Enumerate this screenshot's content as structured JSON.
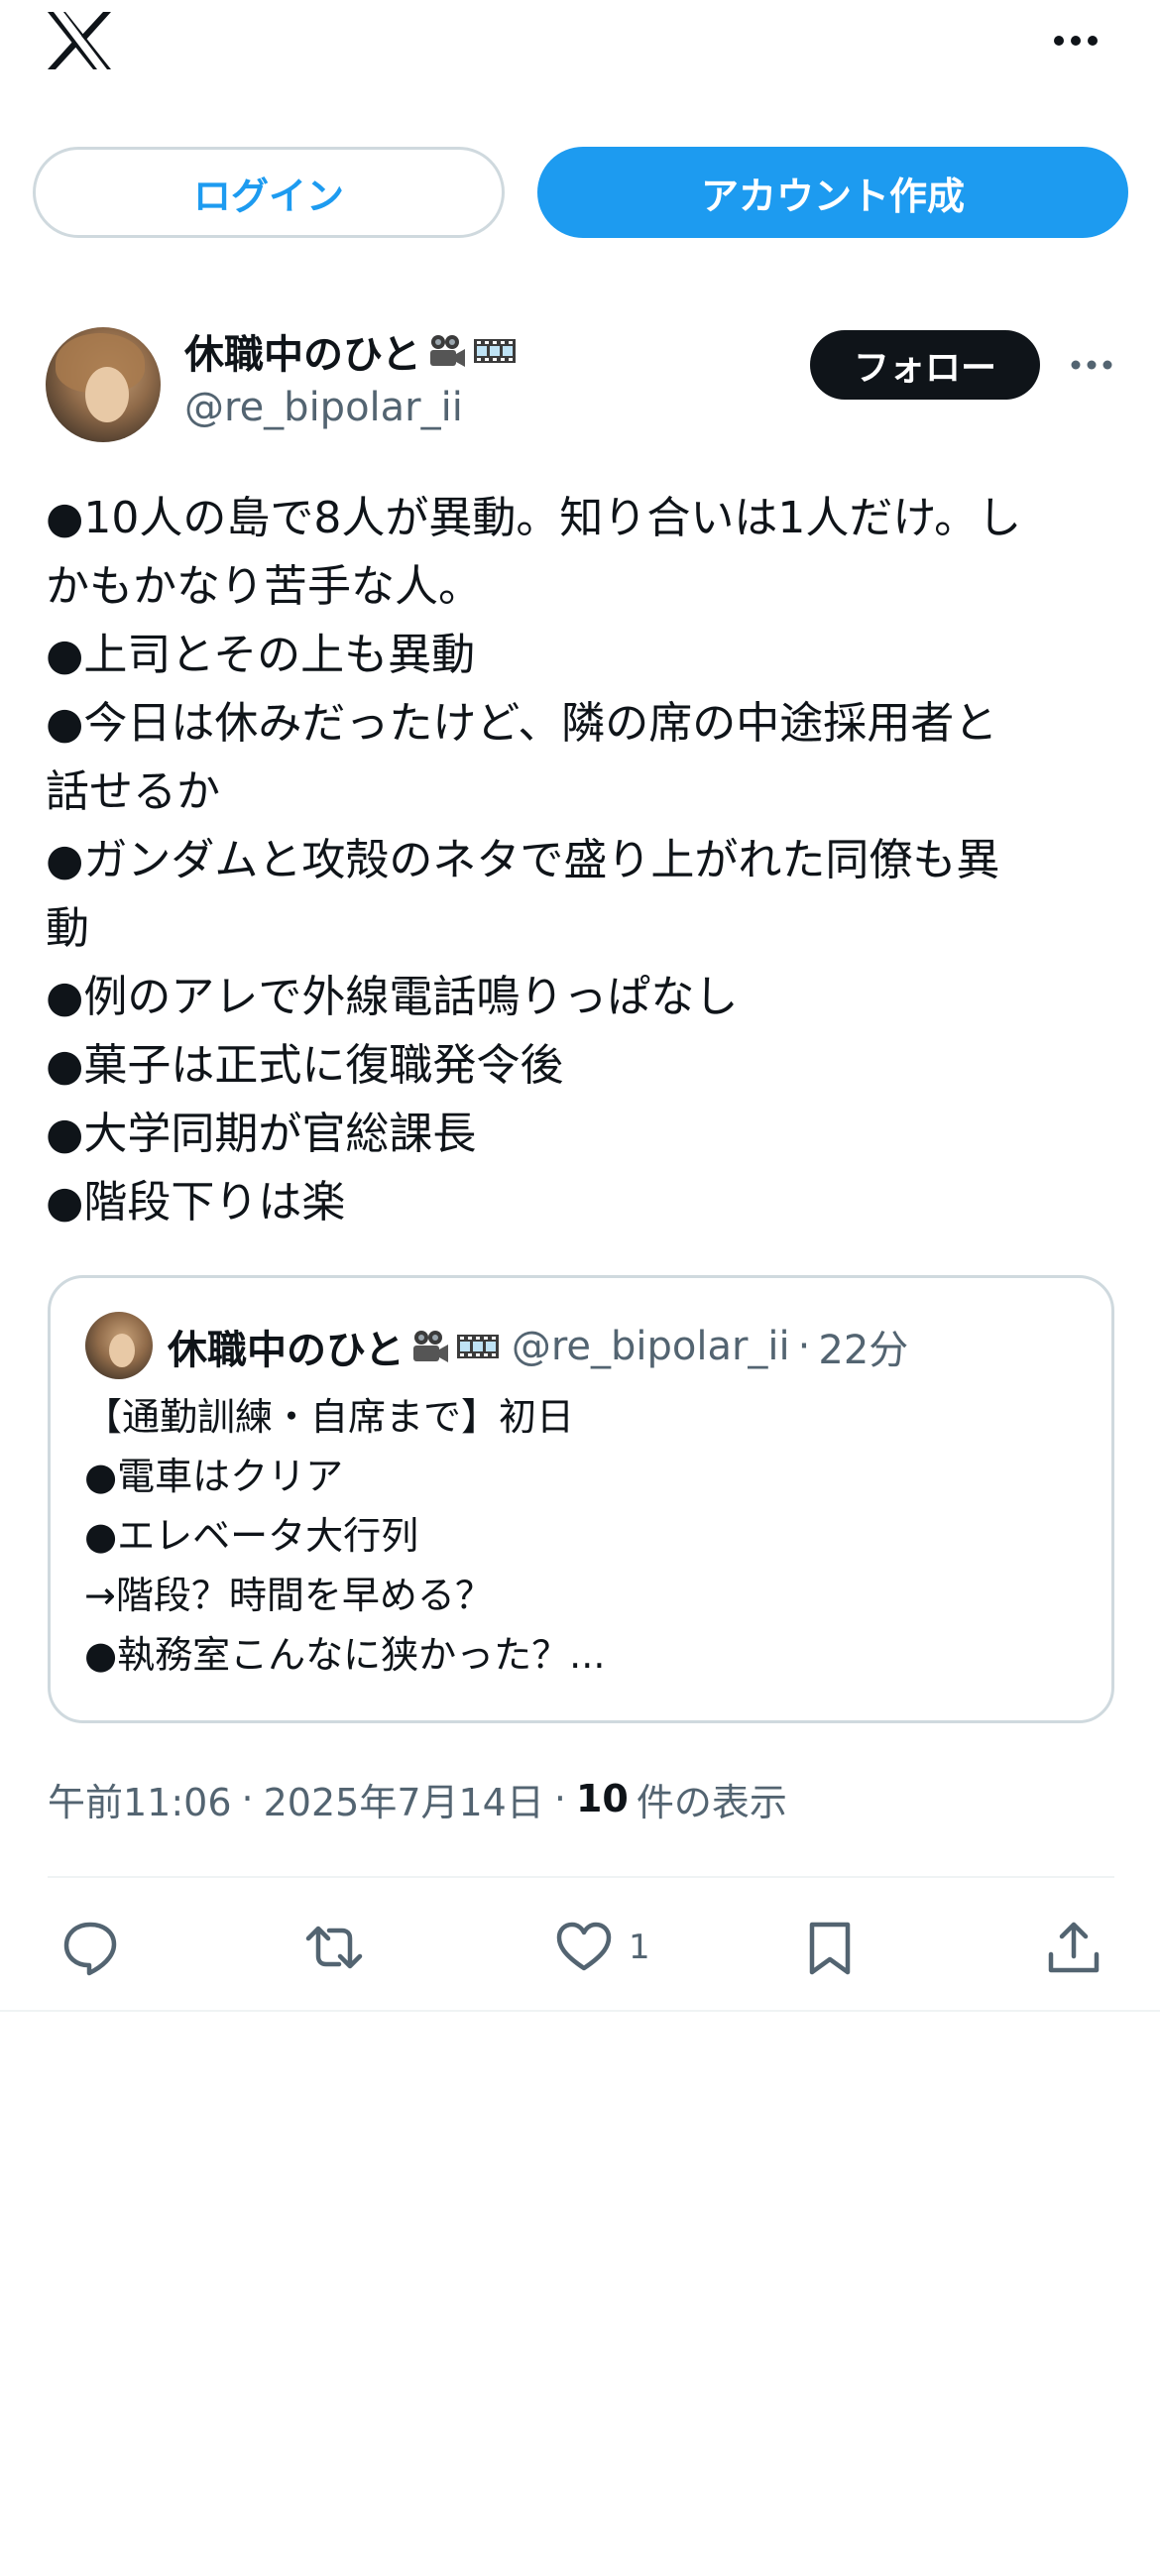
{
  "topbar": {
    "logo_icon": "x-logo-icon",
    "more_icon": "more-horizontal-icon"
  },
  "auth": {
    "login_label": "ログイン",
    "signup_label": "アカウント作成"
  },
  "tweet": {
    "author_name": "休職中のひと",
    "author_emoji": [
      "movie-camera-emoji",
      "film-frames-emoji"
    ],
    "author_handle": "@re_bipolar_ii",
    "follow_label": "フォロー",
    "body_lines": [
      "●10人の島で8人が異動。知り合いは1人だけ。し",
      "かもかなり苦手な人。",
      "●上司とその上も異動",
      "●今日は休みだったけど、隣の席の中途採用者と",
      "話せるか",
      "●ガンダムと攻殻のネタで盛り上がれた同僚も異",
      "動",
      "●例のアレで外線電話鳴りっぱなし",
      "●菓子は正式に復職発令後",
      "●大学同期が官総課長",
      "●階段下りは楽"
    ],
    "quote": {
      "author_name": "休職中のひと",
      "author_handle": "@re_bipolar_ii",
      "separator": "·",
      "time": "22分",
      "body_lines": [
        "【通勤訓練・自席まで】初日",
        "●電車はクリア",
        "●エレベータ大行列",
        "→階段？時間を早める？",
        "●執務室こんなに狭かった？..."
      ]
    },
    "meta": {
      "time": "午前11:06",
      "separator": "·",
      "date": "2025年7月14日",
      "views_count": "10",
      "views_label": "件の表示"
    },
    "actions": {
      "reply_icon": "reply-icon",
      "retweet_icon": "retweet-icon",
      "like_icon": "heart-icon",
      "like_count": "1",
      "bookmark_icon": "bookmark-icon",
      "share_icon": "share-icon"
    }
  },
  "colors": {
    "accent": "#1d9bf0",
    "text": "#0f1419",
    "secondary": "#536471",
    "border": "#cfd9de"
  }
}
